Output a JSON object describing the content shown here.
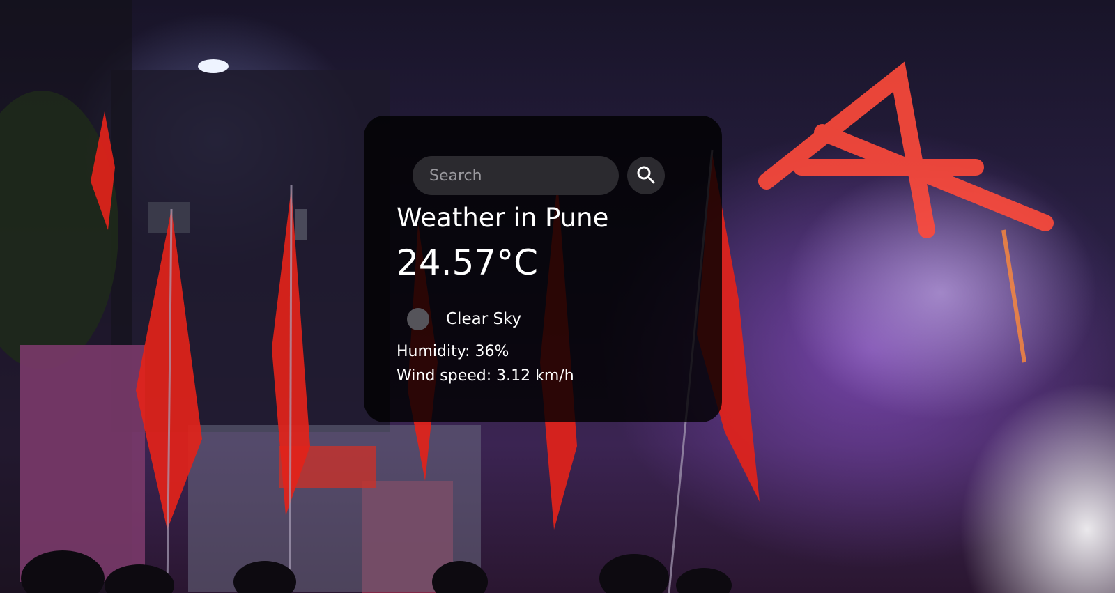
{
  "search": {
    "placeholder": "Search",
    "icon": "search-icon"
  },
  "weather": {
    "city_heading": "Weather in Pune",
    "temperature": "24.57°C",
    "description": "Clear Sky",
    "icon": "weather-condition-icon",
    "humidity": "Humidity: 36%",
    "wind_speed": "Wind speed: 3.12 km/h"
  },
  "colors": {
    "card_background": "#000000cc",
    "input_background": "#2b2a2f",
    "text": "#ffffff",
    "flag_red": "#e2231a"
  }
}
